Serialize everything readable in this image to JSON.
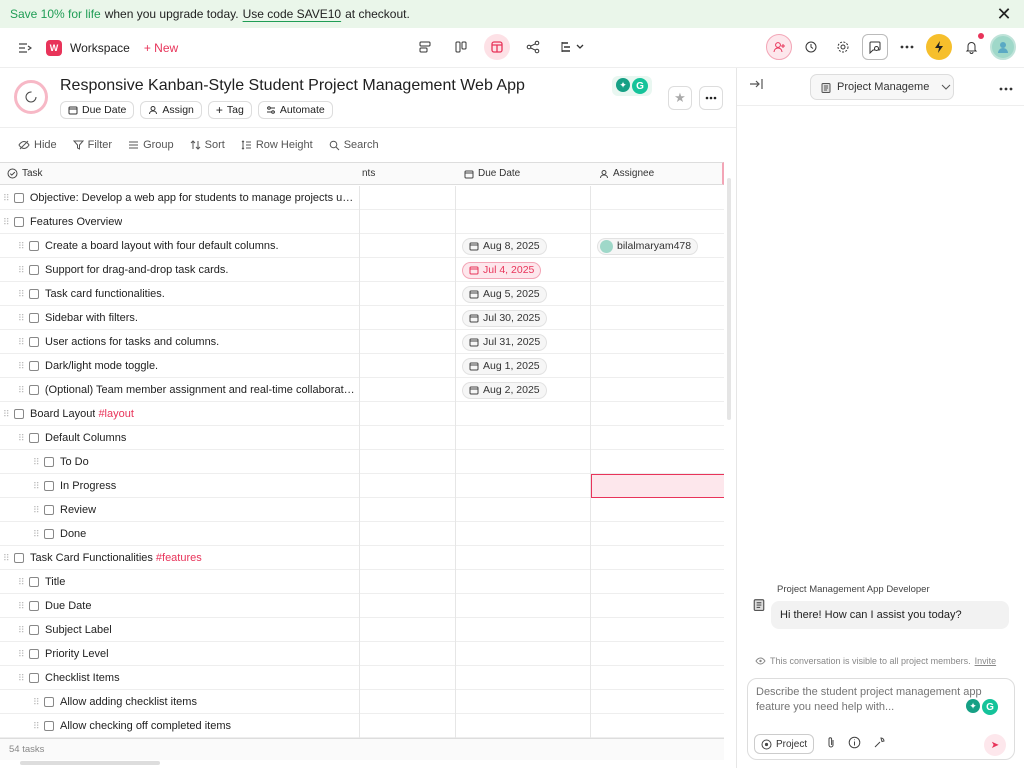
{
  "banner": {
    "promo": "Save 10% for life",
    "text": "when you upgrade today.",
    "code": "Use code SAVE10",
    "suffix": "at checkout.",
    "close": "✕"
  },
  "topbar": {
    "workspace": "Workspace",
    "workspace_logo": "W",
    "new_label": "+ New"
  },
  "project": {
    "title": "Responsive Kanban-Style Student Project Management Web App",
    "chips": [
      "Due Date",
      "Assign",
      "Tag",
      "Automate"
    ]
  },
  "toolbar": {
    "hide": "Hide",
    "filter": "Filter",
    "group": "Group",
    "sort": "Sort",
    "row_height": "Row Height",
    "search": "Search"
  },
  "table": {
    "columns": {
      "task": "Task",
      "comments": "nts",
      "due": "Due Date",
      "assignee": "Assignee"
    },
    "rows": [
      {
        "level": 0,
        "text": "Objective: Develop a web app for students to manage projects usin...",
        "tag": "",
        "date": "",
        "overdue": false,
        "assignee": ""
      },
      {
        "level": 0,
        "text": "Features Overview",
        "tag": "",
        "date": "",
        "overdue": false,
        "assignee": ""
      },
      {
        "level": 1,
        "text": "Create a board layout with four default columns.",
        "tag": "",
        "date": "Aug 8, 2025",
        "overdue": false,
        "assignee": "bilalmaryam478"
      },
      {
        "level": 1,
        "text": "Support for drag-and-drop task cards.",
        "tag": "",
        "date": "Jul 4, 2025",
        "overdue": true,
        "assignee": ""
      },
      {
        "level": 1,
        "text": "Task card functionalities.",
        "tag": "",
        "date": "Aug 5, 2025",
        "overdue": false,
        "assignee": ""
      },
      {
        "level": 1,
        "text": "Sidebar with filters.",
        "tag": "",
        "date": "Jul 30, 2025",
        "overdue": false,
        "assignee": ""
      },
      {
        "level": 1,
        "text": "User actions for tasks and columns.",
        "tag": "",
        "date": "Jul 31, 2025",
        "overdue": false,
        "assignee": ""
      },
      {
        "level": 1,
        "text": "Dark/light mode toggle.",
        "tag": "",
        "date": "Aug 1, 2025",
        "overdue": false,
        "assignee": ""
      },
      {
        "level": 1,
        "text": "(Optional) Team member assignment and real-time collaboration.",
        "tag": "",
        "date": "Aug 2, 2025",
        "overdue": false,
        "assignee": ""
      },
      {
        "level": 0,
        "text": "Board Layout",
        "tag": "#layout",
        "date": "",
        "overdue": false,
        "assignee": ""
      },
      {
        "level": 1,
        "text": "Default Columns",
        "tag": "",
        "date": "",
        "overdue": false,
        "assignee": ""
      },
      {
        "level": 2,
        "text": "To Do",
        "tag": "",
        "date": "",
        "overdue": false,
        "assignee": ""
      },
      {
        "level": 2,
        "text": "In Progress",
        "tag": "",
        "date": "",
        "overdue": false,
        "assignee": ""
      },
      {
        "level": 2,
        "text": "Review",
        "tag": "",
        "date": "",
        "overdue": false,
        "assignee": ""
      },
      {
        "level": 2,
        "text": "Done",
        "tag": "",
        "date": "",
        "overdue": false,
        "assignee": ""
      },
      {
        "level": 0,
        "text": "Task Card Functionalities",
        "tag": "#features",
        "date": "",
        "overdue": false,
        "assignee": ""
      },
      {
        "level": 1,
        "text": "Title",
        "tag": "",
        "date": "",
        "overdue": false,
        "assignee": ""
      },
      {
        "level": 1,
        "text": "Due Date",
        "tag": "",
        "date": "",
        "overdue": false,
        "assignee": ""
      },
      {
        "level": 1,
        "text": "Subject Label",
        "tag": "",
        "date": "",
        "overdue": false,
        "assignee": ""
      },
      {
        "level": 1,
        "text": "Priority Level",
        "tag": "",
        "date": "",
        "overdue": false,
        "assignee": ""
      },
      {
        "level": 1,
        "text": "Checklist Items",
        "tag": "",
        "date": "",
        "overdue": false,
        "assignee": ""
      },
      {
        "level": 2,
        "text": "Allow adding checklist items",
        "tag": "",
        "date": "",
        "overdue": false,
        "assignee": ""
      },
      {
        "level": 2,
        "text": "Allow checking off completed items",
        "tag": "",
        "date": "",
        "overdue": false,
        "assignee": ""
      }
    ],
    "footer": "54 tasks"
  },
  "chat": {
    "selector": "Project Manageme",
    "bot_name": "Project Management App Developer",
    "message": "Hi there! How can I assist you today?",
    "visibility": "This conversation is visible to all project members.",
    "invite": "Invite",
    "placeholder": "Describe the student project management app feature you need help with...",
    "project_chip": "Project"
  },
  "colors": {
    "accent": "#e8345a",
    "banner_bg": "#eaf6ea",
    "promo_green": "#1f9d55"
  }
}
